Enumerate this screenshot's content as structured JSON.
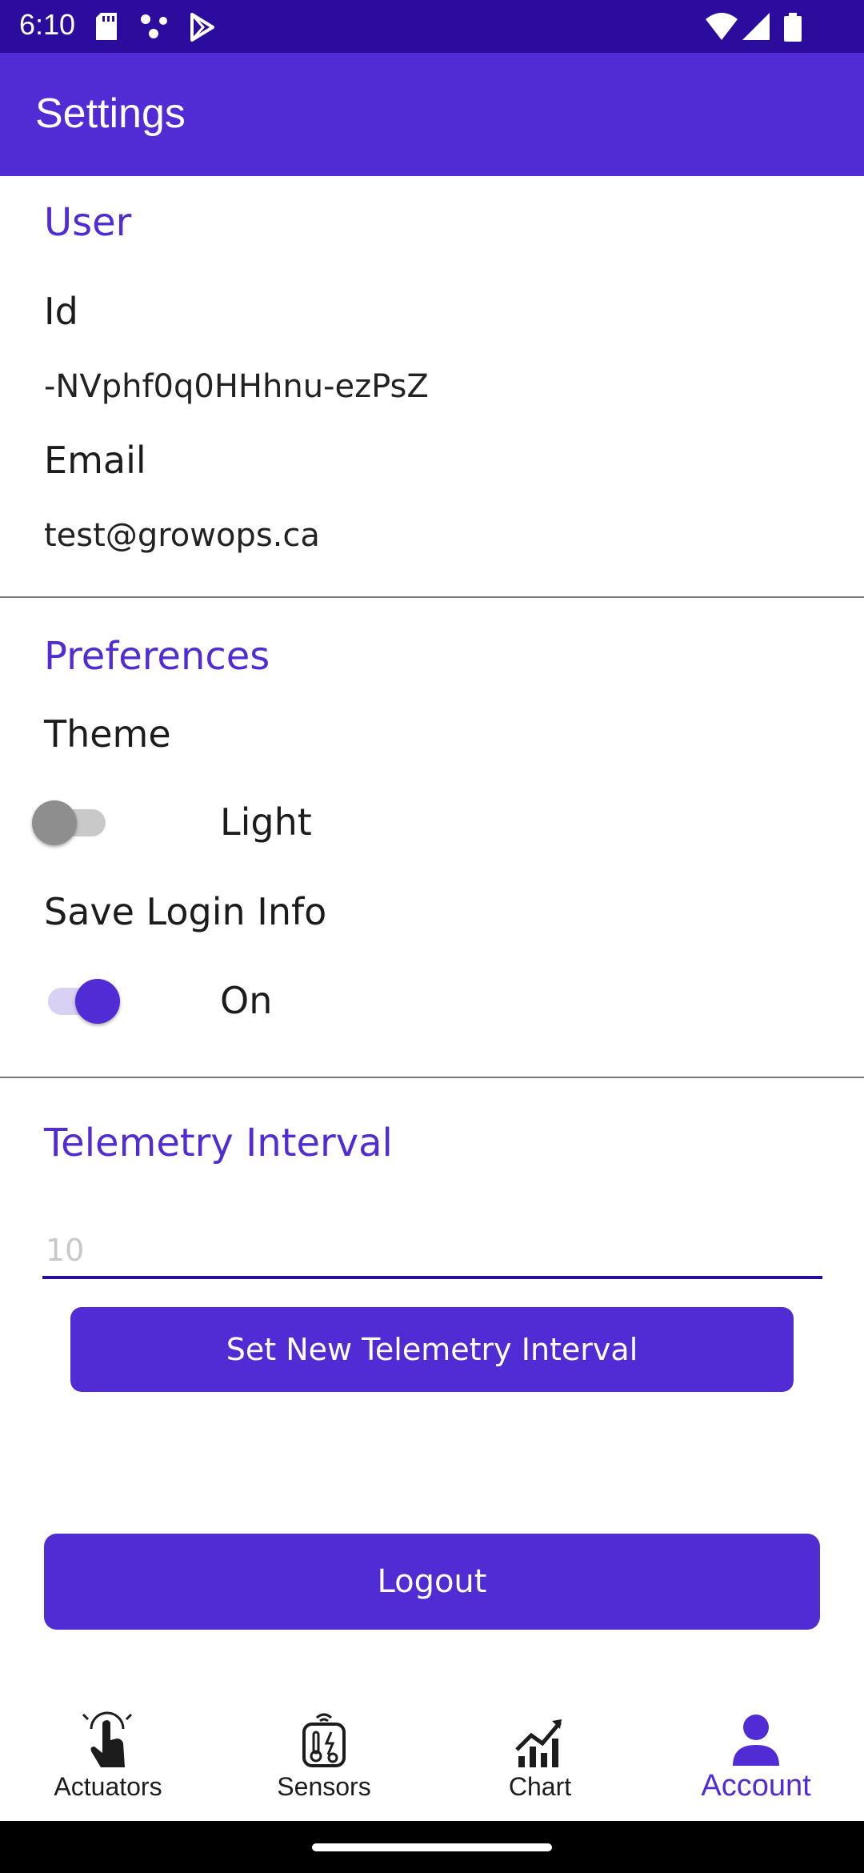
{
  "status": {
    "time": "6:10"
  },
  "app_bar": {
    "title": "Settings"
  },
  "user": {
    "section_title": "User",
    "id_label": "Id",
    "id_value": "-NVphf0q0HHhnu-ezPsZ",
    "email_label": "Email",
    "email_value": "test@growops.ca"
  },
  "preferences": {
    "section_title": "Preferences",
    "theme_label": "Theme",
    "theme_state": "Light",
    "theme_on": false,
    "save_login_label": "Save Login Info",
    "save_login_state": "On",
    "save_login_on": true
  },
  "telemetry": {
    "section_title": "Telemetry Interval",
    "placeholder": "10",
    "button_label": "Set New Telemetry Interval"
  },
  "logout": {
    "label": "Logout"
  },
  "bottom_nav": {
    "items": [
      {
        "label": "Actuators",
        "icon": "touch-hand-icon",
        "active": false
      },
      {
        "label": "Sensors",
        "icon": "sensor-device-icon",
        "active": false
      },
      {
        "label": "Chart",
        "icon": "chart-trend-icon",
        "active": false
      },
      {
        "label": "Account",
        "icon": "person-icon",
        "active": true
      }
    ]
  },
  "colors": {
    "status_bar": "#2b0c9c",
    "primary": "#512bd4",
    "text": "#1c1c1c",
    "divider": "#7a7a7a"
  }
}
